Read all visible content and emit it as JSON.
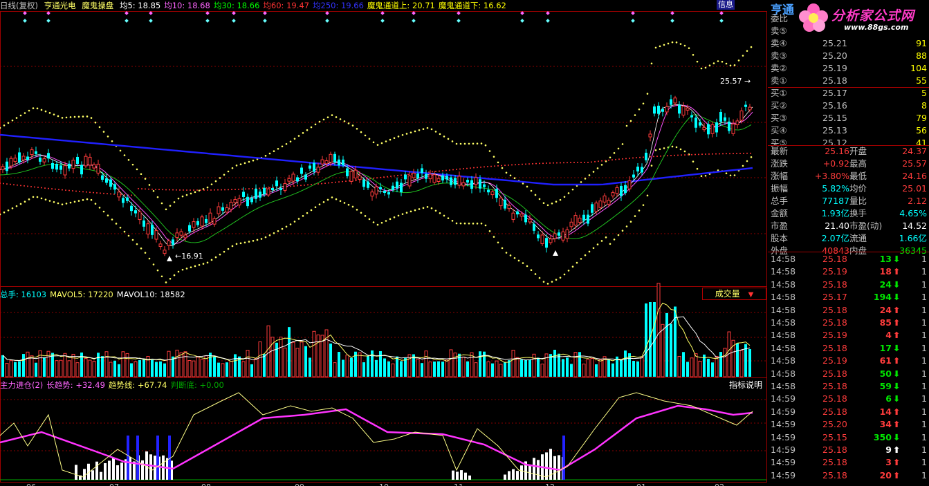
{
  "header": {
    "period": "日线(复权)",
    "stock_name": "亨通光电",
    "indicator": "魔鬼操盘",
    "ma": [
      {
        "label": "均5: 18.85",
        "color": "#ffffff"
      },
      {
        "label": "均10: 18.68",
        "color": "#ff66ff"
      },
      {
        "label": "均30: 18.66",
        "color": "#00ff00"
      },
      {
        "label": "均60: 19.47",
        "color": "#ff3333"
      },
      {
        "label": "均250: 19.66",
        "color": "#3333ff"
      },
      {
        "label": "魔鬼通道上: 20.71",
        "color": "#ffff00"
      },
      {
        "label": "魔鬼通道下: 16.62",
        "color": "#ffff00"
      }
    ],
    "info_button": "信息",
    "side_title": "亨通"
  },
  "price_chart": {
    "high_label": "25.57",
    "low_label": "16.91"
  },
  "volume_panel": {
    "header": [
      {
        "label": "总手: 16103",
        "color": "#00ffff"
      },
      {
        "label": "MAVOL5: 17220",
        "color": "#ffff66"
      },
      {
        "label": "MAVOL10: 18582",
        "color": "#ffffff"
      }
    ],
    "selector": "成交量",
    "selector_arrow": "▼"
  },
  "indicator_panel": {
    "header": [
      {
        "label": "主力进仓(2)",
        "color": "#ff66ff"
      },
      {
        "label": "长趋势: +32.49",
        "color": "#ff66ff"
      },
      {
        "label": "趋势线: +67.74",
        "color": "#ffff66"
      },
      {
        "label": "判断底: +0.00",
        "color": "#00aa00"
      }
    ],
    "explain_button": "指标说明"
  },
  "x_axis": {
    "ticks": [
      "06",
      "07",
      "08",
      "09",
      "10",
      "11",
      "12",
      "01",
      "02"
    ]
  },
  "logo": {
    "text": "分析家公式网",
    "url": "www.88gs.com"
  },
  "order_book": {
    "ratio_label": "委比",
    "asks": [
      {
        "label": "卖⑤",
        "price": "",
        "vol": ""
      },
      {
        "label": "卖④",
        "price": "25.21",
        "vol": "91"
      },
      {
        "label": "卖③",
        "price": "25.20",
        "vol": "88"
      },
      {
        "label": "卖②",
        "price": "25.19",
        "vol": "104"
      },
      {
        "label": "卖①",
        "price": "25.18",
        "vol": "55"
      }
    ],
    "bids": [
      {
        "label": "买①",
        "price": "25.17",
        "vol": "5"
      },
      {
        "label": "买②",
        "price": "25.16",
        "vol": "8"
      },
      {
        "label": "买③",
        "price": "25.15",
        "vol": "79"
      },
      {
        "label": "买④",
        "price": "25.13",
        "vol": "56"
      },
      {
        "label": "买⑤",
        "price": "25.12",
        "vol": "41"
      }
    ]
  },
  "quote": [
    {
      "l1": "最新",
      "v1": "25.16",
      "c1": "red",
      "l2": "开盘",
      "v2": "24.37",
      "c2": "red"
    },
    {
      "l1": "涨跌",
      "v1": "+0.92",
      "c1": "red",
      "l2": "最高",
      "v2": "25.57",
      "c2": "red"
    },
    {
      "l1": "涨幅",
      "v1": "+3.80%",
      "c1": "red",
      "l2": "最低",
      "v2": "24.16",
      "c2": "red"
    },
    {
      "l1": "振幅",
      "v1": "5.82%",
      "c1": "cyan",
      "l2": "均价",
      "v2": "25.01",
      "c2": "red"
    },
    {
      "l1": "总手",
      "v1": "77187",
      "c1": "cyan",
      "l2": "量比",
      "v2": "2.12",
      "c2": "red"
    },
    {
      "l1": "金额",
      "v1": "1.93亿",
      "c1": "cyan",
      "l2": "换手",
      "v2": "4.65%",
      "c2": "cyan"
    },
    {
      "l1": "市盈",
      "v1": "21.40",
      "c1": "wht",
      "l2": "市盈(动)",
      "v2": "14.52",
      "c2": "wht"
    },
    {
      "l1": "股本",
      "v1": "2.07亿",
      "c1": "cyan",
      "l2": "流通",
      "v2": "1.66亿",
      "c2": "cyan"
    },
    {
      "l1": "外盘",
      "v1": "40843",
      "c1": "red",
      "l2": "内盘",
      "v2": "36345",
      "c2": "grn"
    }
  ],
  "ticks": [
    {
      "time": "14:58",
      "price": "25.18",
      "vol": "13",
      "dir": "down",
      "count": "1"
    },
    {
      "time": "14:58",
      "price": "25.19",
      "vol": "18",
      "dir": "up",
      "count": "1"
    },
    {
      "time": "14:58",
      "price": "25.18",
      "vol": "24",
      "dir": "down",
      "count": "1"
    },
    {
      "time": "14:58",
      "price": "25.17",
      "vol": "194",
      "dir": "down",
      "count": "1"
    },
    {
      "time": "14:58",
      "price": "25.18",
      "vol": "24",
      "dir": "up",
      "count": "1"
    },
    {
      "time": "14:58",
      "price": "25.18",
      "vol": "85",
      "dir": "up",
      "count": "1"
    },
    {
      "time": "14:58",
      "price": "25.19",
      "vol": "4",
      "dir": "up",
      "count": "1"
    },
    {
      "time": "14:58",
      "price": "25.18",
      "vol": "17",
      "dir": "down",
      "count": "1"
    },
    {
      "time": "14:58",
      "price": "25.19",
      "vol": "61",
      "dir": "up",
      "count": "1"
    },
    {
      "time": "14:58",
      "price": "25.18",
      "vol": "50",
      "dir": "down",
      "count": "1"
    },
    {
      "time": "14:58",
      "price": "25.18",
      "vol": "59",
      "dir": "down",
      "count": "1"
    },
    {
      "time": "14:59",
      "price": "25.18",
      "vol": "6",
      "dir": "down",
      "count": "1"
    },
    {
      "time": "14:59",
      "price": "25.18",
      "vol": "14",
      "dir": "up",
      "count": "1"
    },
    {
      "time": "14:59",
      "price": "25.20",
      "vol": "34",
      "dir": "up",
      "count": "1"
    },
    {
      "time": "14:59",
      "price": "25.15",
      "vol": "350",
      "dir": "down",
      "count": "1"
    },
    {
      "time": "14:59",
      "price": "25.18",
      "vol": "9",
      "dir": "neutral",
      "count": "1"
    },
    {
      "time": "14:59",
      "price": "25.18",
      "vol": "3",
      "dir": "up",
      "count": "1"
    },
    {
      "time": "14:59",
      "price": "25.18",
      "vol": "20",
      "dir": "up",
      "count": "1"
    }
  ],
  "colors": {
    "up": "#ff3c3c",
    "down": "#00ffff",
    "grid": "#8b0000",
    "ma250": "#2020ff",
    "channel": "#ffff66"
  }
}
